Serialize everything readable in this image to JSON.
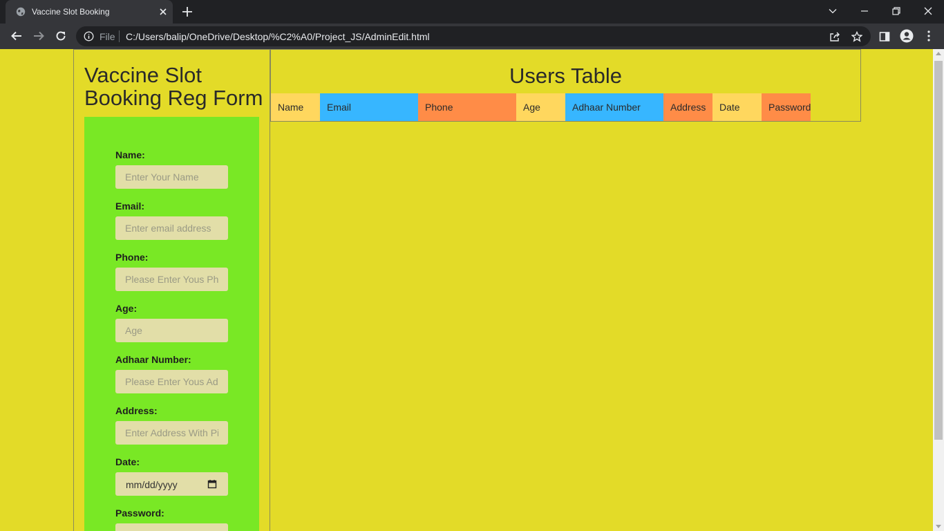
{
  "browser": {
    "tab_title": "Vaccine Slot Booking",
    "omnibox_scheme": "File",
    "url": "C:/Users/balip/OneDrive/Desktop/%C2%A0/Project_JS/AdminEdit.html"
  },
  "form": {
    "title": "Vaccine Slot Booking Reg Form",
    "fields": [
      {
        "label": "Name:",
        "placeholder": "Enter Your Name"
      },
      {
        "label": "Email:",
        "placeholder": "Enter email address"
      },
      {
        "label": "Phone:",
        "placeholder": "Please Enter Yous Phone"
      },
      {
        "label": "Age:",
        "placeholder": "Age"
      },
      {
        "label": "Adhaar Number:",
        "placeholder": "Please Enter Yous Adhaar Number"
      },
      {
        "label": "Address:",
        "placeholder": "Enter Address With Pin"
      },
      {
        "label": "Date:",
        "value": "mm/dd/yyyy"
      },
      {
        "label": "Password:",
        "placeholder": ""
      }
    ]
  },
  "table": {
    "title": "Users Table",
    "columns": [
      {
        "label": "Name",
        "color": "#ffd75e"
      },
      {
        "label": "Email",
        "color": "#37b6ff"
      },
      {
        "label": "Phone",
        "color": "#ff8c47"
      },
      {
        "label": "Age",
        "color": "#ffd75e"
      },
      {
        "label": "Adhaar Number",
        "color": "#37b6ff"
      },
      {
        "label": "Address",
        "color": "#ff8c47"
      },
      {
        "label": "Date",
        "color": "#ffd75e"
      },
      {
        "label": "Password",
        "color": "#ff8c47"
      }
    ]
  },
  "colors": {
    "page_background": "#e3db28",
    "form_background": "#79e825"
  }
}
